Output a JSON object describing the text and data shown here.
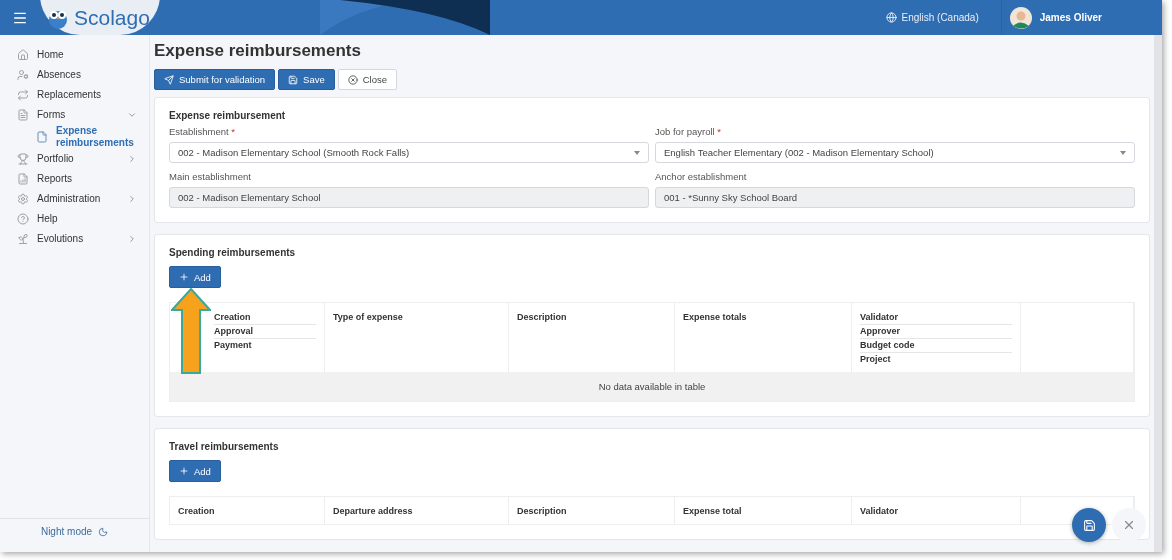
{
  "header": {
    "brand": "Scolago",
    "language": "English (Canada)",
    "user": "James Oliver"
  },
  "sidebar": {
    "items": [
      {
        "label": "Home"
      },
      {
        "label": "Absences"
      },
      {
        "label": "Replacements"
      },
      {
        "label": "Forms",
        "expanded": true,
        "children": [
          {
            "label": "Expense reimbursements",
            "selected": true
          }
        ]
      },
      {
        "label": "Portfolio",
        "expanded": false
      },
      {
        "label": "Reports"
      },
      {
        "label": "Administration",
        "expanded": false
      },
      {
        "label": "Help"
      },
      {
        "label": "Evolutions",
        "expanded": false
      }
    ],
    "night_mode": "Night mode"
  },
  "page": {
    "title": "Expense reimbursements",
    "toolbar": [
      {
        "label": "Submit for validation",
        "kind": "primary"
      },
      {
        "label": "Save",
        "kind": "primary"
      },
      {
        "label": "Close",
        "kind": "secondary"
      }
    ]
  },
  "form": {
    "title": "Expense reimbursement",
    "fields": [
      {
        "label": "Establishment",
        "required_mark": "*",
        "kind": "select",
        "value": "002 - Madison Elementary School (Smooth Rock Falls)"
      },
      {
        "label": "Job for payroll",
        "required_mark": "*",
        "kind": "select",
        "value": "English Teacher Elementary (002 - Madison Elementary School)"
      },
      {
        "label": "Main establishment",
        "kind": "readonly",
        "value": "002 - Madison Elementary School"
      },
      {
        "label": "Anchor establishment",
        "kind": "readonly",
        "value": "001 - *Sunny Sky School Board"
      }
    ]
  },
  "sections": [
    {
      "title": "Spending reimbursements",
      "add_button": "Add",
      "columns": [
        [
          "Creation",
          "Approval",
          "Payment"
        ],
        [
          "Type of expense"
        ],
        [
          "Description"
        ],
        [
          "Expense totals"
        ],
        [
          "Validator",
          "Approver",
          "Budget code",
          "Project"
        ]
      ],
      "empty_message": "No data available in table"
    },
    {
      "title": "Travel reimbursements",
      "add_button": "Add",
      "columns": [
        [
          "Creation"
        ],
        [
          "Departure address"
        ],
        [
          "Description"
        ],
        [
          "Expense total"
        ],
        [
          "Validator"
        ]
      ]
    }
  ]
}
